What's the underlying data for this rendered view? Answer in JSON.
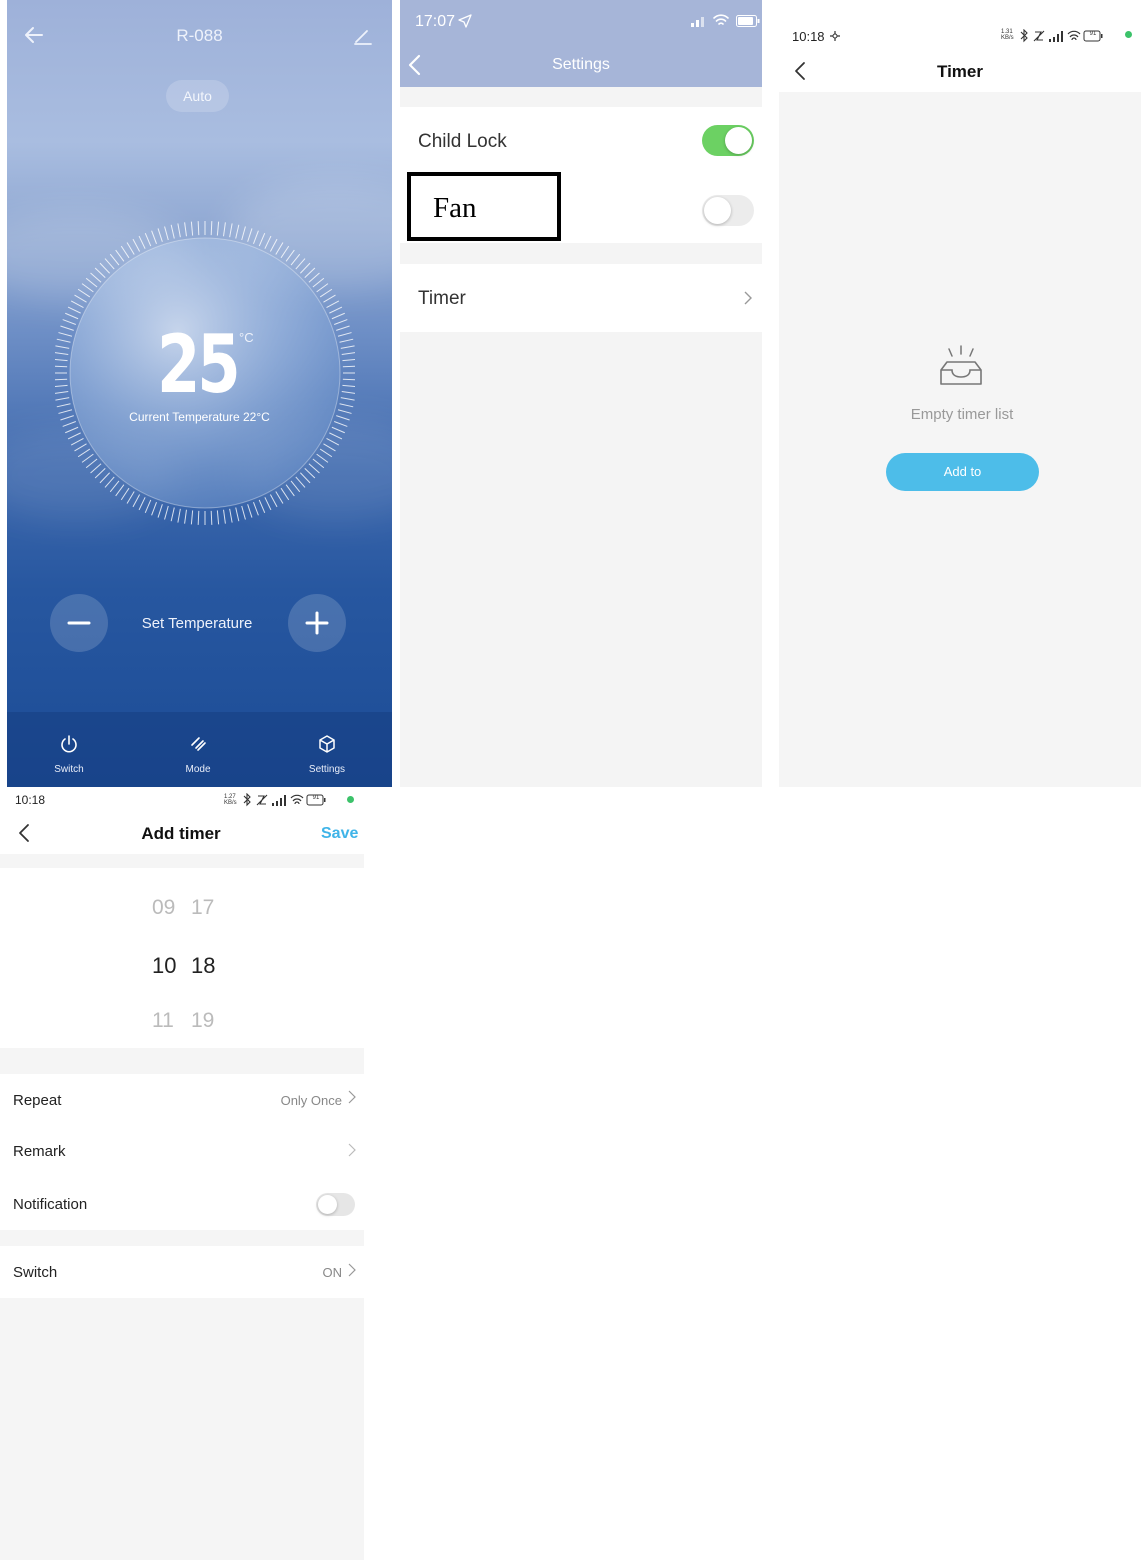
{
  "thermostat": {
    "title": "R-088",
    "mode": "Auto",
    "set_temperature": "25",
    "unit": "°C",
    "current_temperature": "Current Temperature 22°C",
    "set_label": "Set Temperature",
    "tabs": [
      {
        "label": "Switch",
        "icon": "power-icon"
      },
      {
        "label": "Mode",
        "icon": "mode-icon"
      },
      {
        "label": "Settings",
        "icon": "settings-cube-icon"
      }
    ]
  },
  "settings": {
    "status_time": "17:07",
    "title": "Settings",
    "items": [
      {
        "label": "Child Lock",
        "enabled": true
      },
      {
        "label": "Fan",
        "enabled": false
      },
      {
        "label": "Timer"
      }
    ],
    "colors": {
      "toggle_on": "#6cd163",
      "header": "#a6b5d8"
    }
  },
  "timer": {
    "status_time": "10:18",
    "status_speed": "1.31 KB/s",
    "battery": "91",
    "title": "Timer",
    "empty_text": "Empty timer list",
    "add_button": "Add to",
    "colors": {
      "accent": "#4dbde9"
    }
  },
  "add_timer": {
    "status_time": "10:18",
    "status_speed": "1.27 KB/s",
    "battery": "91",
    "title": "Add timer",
    "save": "Save",
    "picker": {
      "hours": [
        "09",
        "10",
        "11"
      ],
      "minutes": [
        "17",
        "18",
        "19"
      ],
      "selected": "10:18"
    },
    "rows": [
      {
        "label": "Repeat",
        "value": "Only Once"
      },
      {
        "label": "Remark",
        "value": ""
      },
      {
        "label": "Notification",
        "enabled": false
      },
      {
        "label": "Switch",
        "value": "ON"
      }
    ]
  }
}
